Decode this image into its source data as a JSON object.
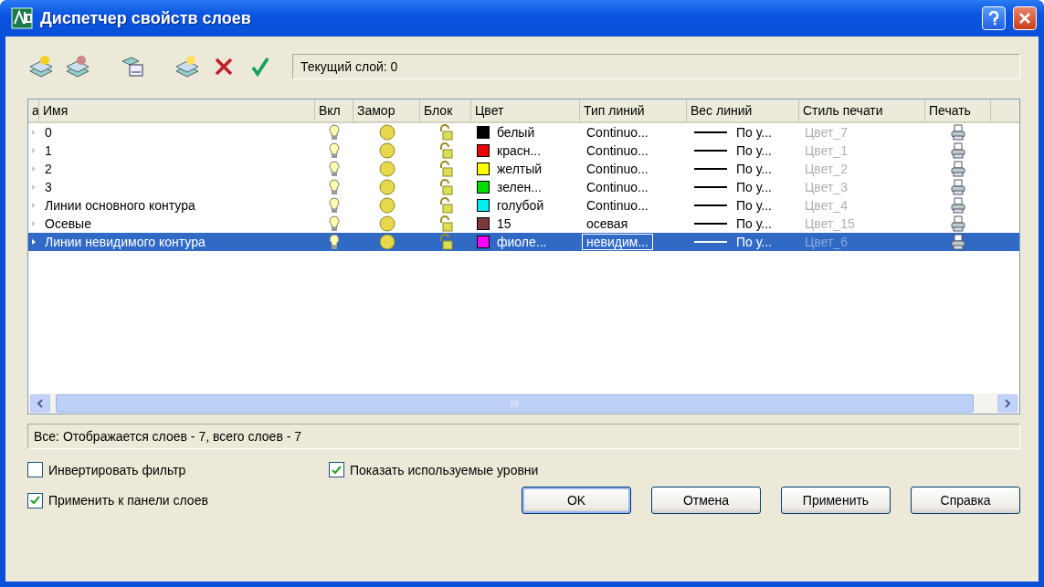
{
  "window": {
    "title": "Диспетчер свойств слоев"
  },
  "current_layer": "Текущий слой: 0",
  "table": {
    "columns": [
      "а",
      "Имя",
      "Вкл",
      "Замор",
      "Блок",
      "Цвет",
      "Тип линий",
      "Вес линий",
      "Стиль печати",
      "Печать"
    ],
    "rows": [
      {
        "name": "0",
        "color": "#000000",
        "color_name": "белый",
        "linetype": "Continuo...",
        "lineweight": "По у...",
        "plot_style": "Цвет_7",
        "selected": false
      },
      {
        "name": "1",
        "color": "#ee0000",
        "color_name": "красн...",
        "linetype": "Continuo...",
        "lineweight": "По у...",
        "plot_style": "Цвет_1",
        "selected": false
      },
      {
        "name": "2",
        "color": "#ffff00",
        "color_name": "желтый",
        "linetype": "Continuo...",
        "lineweight": "По у...",
        "plot_style": "Цвет_2",
        "selected": false
      },
      {
        "name": "3",
        "color": "#00dd00",
        "color_name": "зелен...",
        "linetype": "Continuo...",
        "lineweight": "По у...",
        "plot_style": "Цвет_3",
        "selected": false
      },
      {
        "name": "Линии основного контура",
        "color": "#00eeee",
        "color_name": "голубой",
        "linetype": "Continuo...",
        "lineweight": "По у...",
        "plot_style": "Цвет_4",
        "selected": false
      },
      {
        "name": "Осевые",
        "color": "#7a3a3a",
        "color_name": "15",
        "linetype": "осевая",
        "lineweight": "По у...",
        "plot_style": "Цвет_15",
        "selected": false
      },
      {
        "name": "Линии невидимого контура",
        "color": "#ff00ff",
        "color_name": "фиоле...",
        "linetype": "невидим...",
        "lineweight": "По у...",
        "plot_style": "Цвет_6",
        "selected": true
      }
    ]
  },
  "status": "Все: Отображается слоев - 7, всего слоев - 7",
  "options": [
    {
      "label": "Инвертировать фильтр",
      "checked": false
    },
    {
      "label": "Показать используемые уровни",
      "checked": true
    },
    {
      "label": "Применить к панели слоев",
      "checked": true
    }
  ],
  "buttons": [
    {
      "label": "OK",
      "default": true
    },
    {
      "label": "Отмена",
      "default": false
    },
    {
      "label": "Применить",
      "default": false
    },
    {
      "label": "Справка",
      "default": false
    }
  ]
}
